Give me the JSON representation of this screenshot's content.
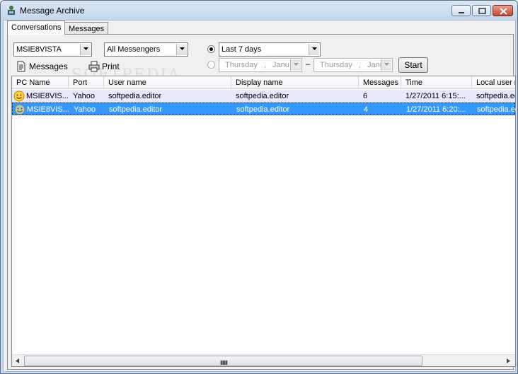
{
  "window": {
    "title": "Message Archive"
  },
  "tabs": [
    {
      "label": "Conversations",
      "active": true
    },
    {
      "label": "Messages",
      "active": false
    }
  ],
  "filters": {
    "pc": "MSIE8VISTA",
    "messenger": "All Messengers",
    "period": "Last 7 days",
    "date_from_day": "Thursday",
    "date_from_sep": ",",
    "date_from_month": "Janu",
    "range_dash": "–",
    "date_to_day": "Thursday",
    "date_to_sep": ",",
    "date_to_month": "Janu",
    "start_label": "Start"
  },
  "toolbar": {
    "messages_label": "Messages",
    "print_label": "Print"
  },
  "watermark": "SOFTPEDIA",
  "table": {
    "columns": [
      "PC Name",
      "Port",
      "User name",
      "Display name",
      "Messages",
      "Time",
      "Local user n"
    ],
    "rows": [
      {
        "pc": "MSIE8VIS...",
        "port": "Yahoo",
        "user": "softpedia.editor",
        "display": "softpedia.editor",
        "messages": "6",
        "time": "1/27/2011 6:15:...",
        "local": "softpedia.ec",
        "icon": "smiley-icon"
      },
      {
        "pc": "MSIE8VIS...",
        "port": "Yahoo",
        "user": "softpedia.editor",
        "display": "softpedia.editor",
        "messages": "4",
        "time": "1/27/2011 6:20:...",
        "local": "softpedia.ec",
        "icon": "offline-smiley-icon"
      }
    ]
  },
  "colors": {
    "selection": "#3399ff",
    "row_alt": "#e8e8fc",
    "titlebar": "#c9dbee"
  }
}
